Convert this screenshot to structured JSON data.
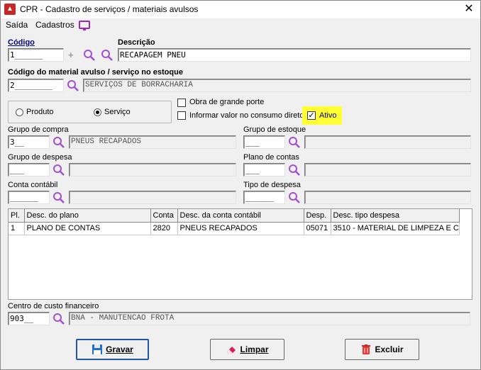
{
  "window": {
    "title": "CPR - Cadastro de serviços / materiais avulsos",
    "close": "✕"
  },
  "menu": {
    "saida": "Saída",
    "cadastros": "Cadastros"
  },
  "codigo": {
    "label": "Código",
    "value": "1______"
  },
  "descricao": {
    "label": "Descrição",
    "value": "RECAPAGEM PNEU"
  },
  "estoque": {
    "label": "Código do material avulso / serviço no estoque",
    "code": "2________",
    "desc": "SERVIÇOS DE BORRACHARIA"
  },
  "tipo": {
    "produto": "Produto",
    "servico": "Serviço",
    "selected": "servico"
  },
  "options": {
    "obra": "Obra de grande porte",
    "informar": "Informar valor no consumo direto",
    "ativo": "Ativo",
    "ativo_checked": "✓"
  },
  "grupo_compra": {
    "label": "Grupo de compra",
    "code": "3__",
    "desc": "PNEUS RECAPADOS"
  },
  "grupo_estoque": {
    "label": "Grupo de estoque",
    "code": "___",
    "desc": ""
  },
  "grupo_despesa": {
    "label": "Grupo de despesa",
    "code": "___",
    "desc": ""
  },
  "plano_contas": {
    "label": "Plano de contas",
    "code": "___",
    "desc": ""
  },
  "conta_contabil": {
    "label": "Conta contábil",
    "code": "______",
    "desc": ""
  },
  "tipo_despesa": {
    "label": "Tipo de despesa",
    "code": "______",
    "desc": ""
  },
  "grid": {
    "headers": [
      "Pl.",
      "Desc. do plano",
      "Conta",
      "Desc. da conta contábil",
      "Desp.",
      "Desc. tipo despesa"
    ],
    "rows": [
      [
        "1",
        "PLANO DE CONTAS",
        "2820",
        "PNEUS RECAPADOS",
        "05071",
        "3510 - MATERIAL DE LIMPEZA E C"
      ]
    ]
  },
  "centro_custo": {
    "label": "Centro de custo financeiro",
    "code": "903__",
    "desc": "BNA - MANUTENCAO FROTA"
  },
  "buttons": {
    "gravar": "Gravar",
    "limpar": "Limpar",
    "excluir": "Excluir"
  },
  "colors": {
    "lupa": "#a050d0",
    "highlight": "#ffff33"
  }
}
